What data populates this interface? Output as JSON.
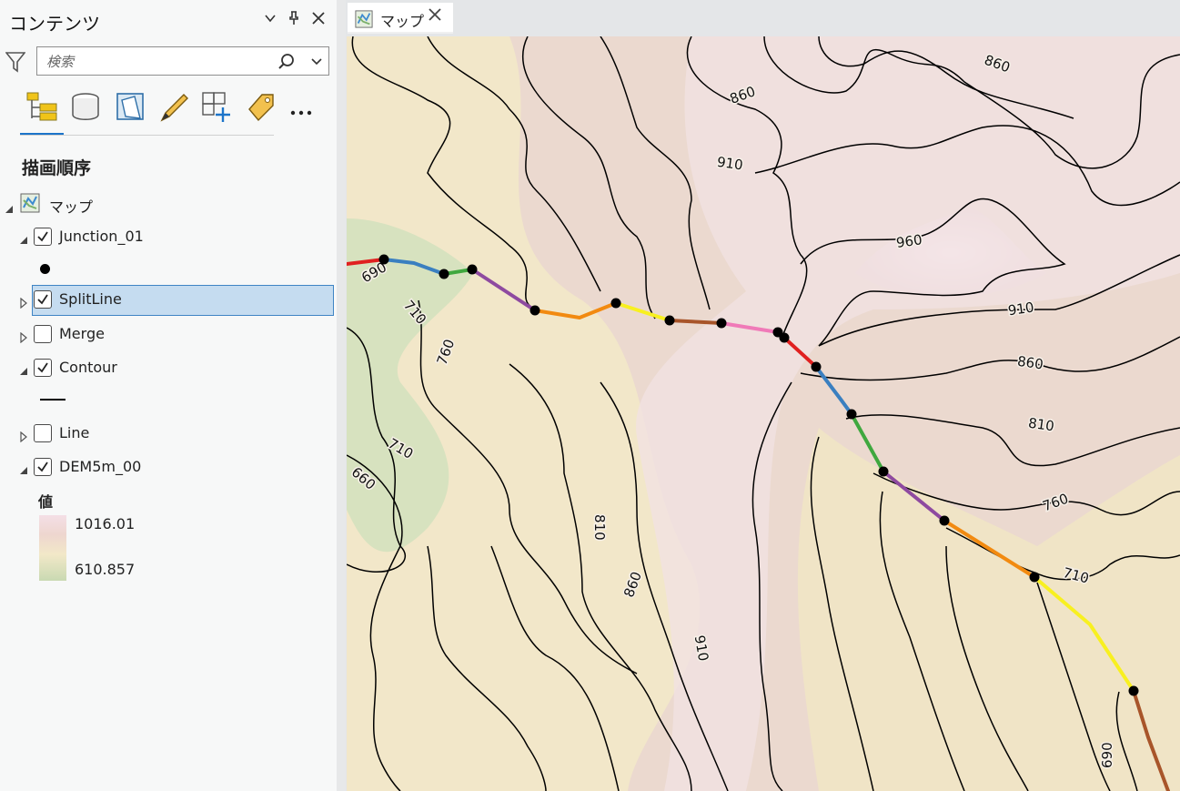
{
  "contents_pane": {
    "title": "コンテンツ",
    "search_placeholder": "検索",
    "drawing_order_title": "描画順序",
    "map_name": "マップ",
    "layers": [
      {
        "name": "Junction_01",
        "checked": true,
        "expanded": true
      },
      {
        "name": "SplitLine",
        "checked": true,
        "expanded": false,
        "selected": true
      },
      {
        "name": "Merge",
        "checked": false,
        "expanded": false
      },
      {
        "name": "Contour",
        "checked": true,
        "expanded": true
      },
      {
        "name": "Line",
        "checked": false,
        "expanded": false
      },
      {
        "name": "DEM5m_00",
        "checked": true,
        "expanded": true
      }
    ],
    "legend": {
      "label": "値",
      "high": "1016.01",
      "low": "610.857"
    }
  },
  "map_tab": {
    "label": "マップ"
  },
  "contour_labels": [
    "860",
    "860",
    "910",
    "960",
    "910",
    "860",
    "810",
    "760",
    "710",
    "690",
    "710",
    "760",
    "710",
    "660",
    "810",
    "860",
    "910",
    "690",
    "660"
  ],
  "colors": {
    "accent": "#1c74c9",
    "selection": "#c5dcf0",
    "segment_red": "#e02020",
    "segment_blue": "#3a7fc0",
    "segment_green": "#3fa83f",
    "segment_purple": "#8e4aa0",
    "segment_orange": "#f28a10",
    "segment_yellow": "#f8f020",
    "segment_brown": "#a8552a",
    "segment_pink": "#f07ab8"
  }
}
